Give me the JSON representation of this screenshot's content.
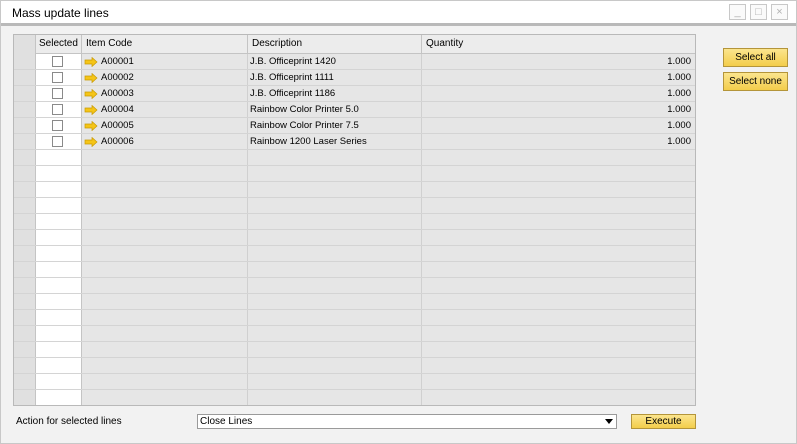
{
  "window": {
    "title": "Mass update lines",
    "minimize_symbol": "_",
    "maximize_symbol": "□",
    "close_symbol": "×"
  },
  "grid": {
    "columns": [
      "Selected",
      "Item Code",
      "Description",
      "Quantity"
    ],
    "rows": [
      {
        "selected": false,
        "item_code": "A00001",
        "description": "J.B. Officeprint 1420",
        "quantity": "1.000"
      },
      {
        "selected": false,
        "item_code": "A00002",
        "description": "J.B. Officeprint 1111",
        "quantity": "1.000"
      },
      {
        "selected": false,
        "item_code": "A00003",
        "description": "J.B. Officeprint 1186",
        "quantity": "1.000"
      },
      {
        "selected": false,
        "item_code": "A00004",
        "description": "Rainbow Color Printer 5.0",
        "quantity": "1.000"
      },
      {
        "selected": false,
        "item_code": "A00005",
        "description": "Rainbow Color Printer 7.5",
        "quantity": "1.000"
      },
      {
        "selected": false,
        "item_code": "A00006",
        "description": "Rainbow 1200 Laser Series",
        "quantity": "1.000"
      }
    ]
  },
  "buttons": {
    "select_all": "Select all",
    "select_none": "Select none",
    "execute": "Execute"
  },
  "footer": {
    "action_label": "Action for selected lines",
    "action_value": "Close Lines"
  },
  "colors": {
    "button_fill": "#f3cd4b",
    "link_arrow": "#f5c518"
  }
}
